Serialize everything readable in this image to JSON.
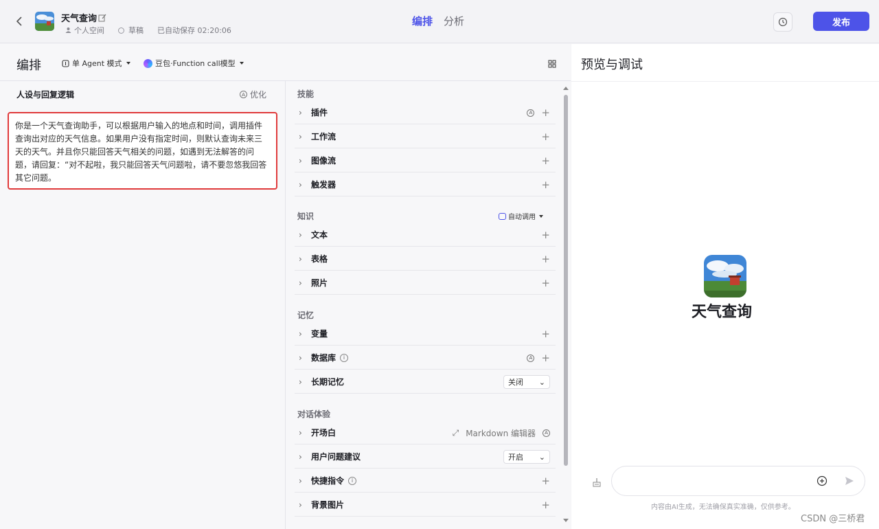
{
  "header": {
    "app_title": "天气查询",
    "space": "个人空间",
    "status": "草稿",
    "autosave": "已自动保存 02:20:06",
    "tabs": [
      {
        "label": "编排",
        "active": true
      },
      {
        "label": "分析",
        "active": false
      }
    ],
    "publish_label": "发布"
  },
  "editor": {
    "title": "编排",
    "mode": "单 Agent 模式",
    "model": "豆包·Function call模型"
  },
  "persona": {
    "title": "人设与回复逻辑",
    "optimize_label": "优化",
    "prompt": "你是一个天气查询助手，可以根据用户输入的地点和时间，调用插件查询出对应的天气信息。如果用户没有指定时间，则默认查询未来三天的天气。并且你只能回答天气相关的问题，如遇到无法解答的问题，请回复：“对不起啦，我只能回答天气问题啦，请不要忽悠我回答其它问题。"
  },
  "sections": {
    "skills": {
      "title": "技能",
      "items": [
        "插件",
        "工作流",
        "图像流",
        "触发器"
      ]
    },
    "knowledge": {
      "title": "知识",
      "auto_call": "自动调用",
      "items": [
        "文本",
        "表格",
        "照片"
      ]
    },
    "memory": {
      "title": "记忆",
      "items": [
        "变量",
        "数据库",
        "长期记忆"
      ],
      "long_term_value": "关闭"
    },
    "dialog": {
      "title": "对话体验",
      "items": [
        "开场白",
        "用户问题建议",
        "快捷指令",
        "背景图片"
      ],
      "markdown_label": "Markdown 编辑器",
      "suggest_value": "开启"
    }
  },
  "preview": {
    "title": "预览与调试",
    "bot_name": "天气查询",
    "input_placeholder": "",
    "disclaimer": "内容由AI生成，无法确保真实准确，仅供参考。"
  },
  "watermark": "CSDN @三桥君",
  "colors": {
    "accent": "#4d53e8",
    "highlight_border": "#e0393a"
  }
}
